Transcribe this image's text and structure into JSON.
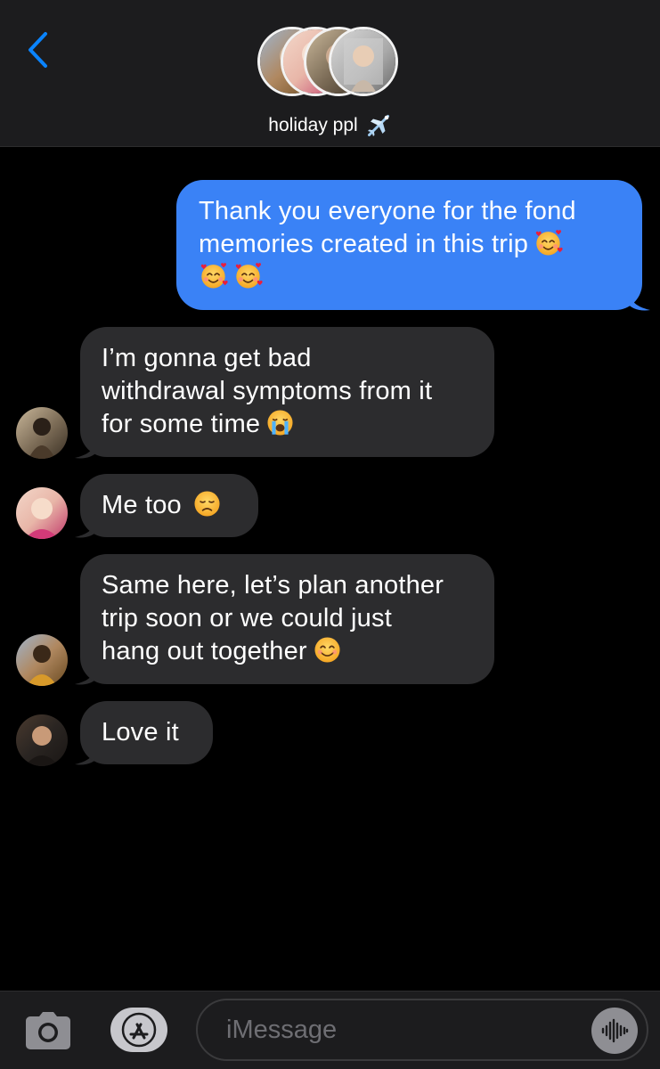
{
  "colors": {
    "background": "#000000",
    "header_bg": "#1c1c1e",
    "outgoing_bubble": "#3a82f6",
    "incoming_bubble": "#2c2c2e",
    "accent": "#0a84ff"
  },
  "header": {
    "back_icon": "chevron-left-icon",
    "group_name": "holiday ppl",
    "group_emoji": "airplane-icon",
    "member_avatars": [
      "avatar-1",
      "avatar-2",
      "avatar-3",
      "avatar-4"
    ]
  },
  "messages": [
    {
      "direction": "outgoing",
      "lines": [
        "Thank you everyone for the fond",
        "memories created in this trip"
      ],
      "emojis": [
        "smiling-face-with-hearts-icon",
        "smiling-face-with-hearts-icon",
        "smiling-face-with-hearts-icon"
      ]
    },
    {
      "direction": "incoming",
      "lines": [
        "I’m gonna get bad",
        "withdrawal symptoms from it",
        "for some time"
      ],
      "emojis": [
        "loudly-crying-face-icon"
      ]
    },
    {
      "direction": "incoming",
      "lines": [
        "Me too"
      ],
      "emojis": [
        "disappointed-face-icon"
      ]
    },
    {
      "direction": "incoming",
      "lines": [
        "Same here, let’s plan another",
        "trip soon or we could just",
        "hang out together"
      ],
      "emojis": [
        "smiling-face-with-smiling-eyes-icon"
      ]
    },
    {
      "direction": "incoming",
      "lines": [
        "Love it"
      ],
      "emojis": []
    }
  ],
  "composer": {
    "camera_icon": "camera-icon",
    "apps_icon": "app-store-icon",
    "placeholder": "iMessage",
    "audio_icon": "audio-waveform-icon"
  }
}
